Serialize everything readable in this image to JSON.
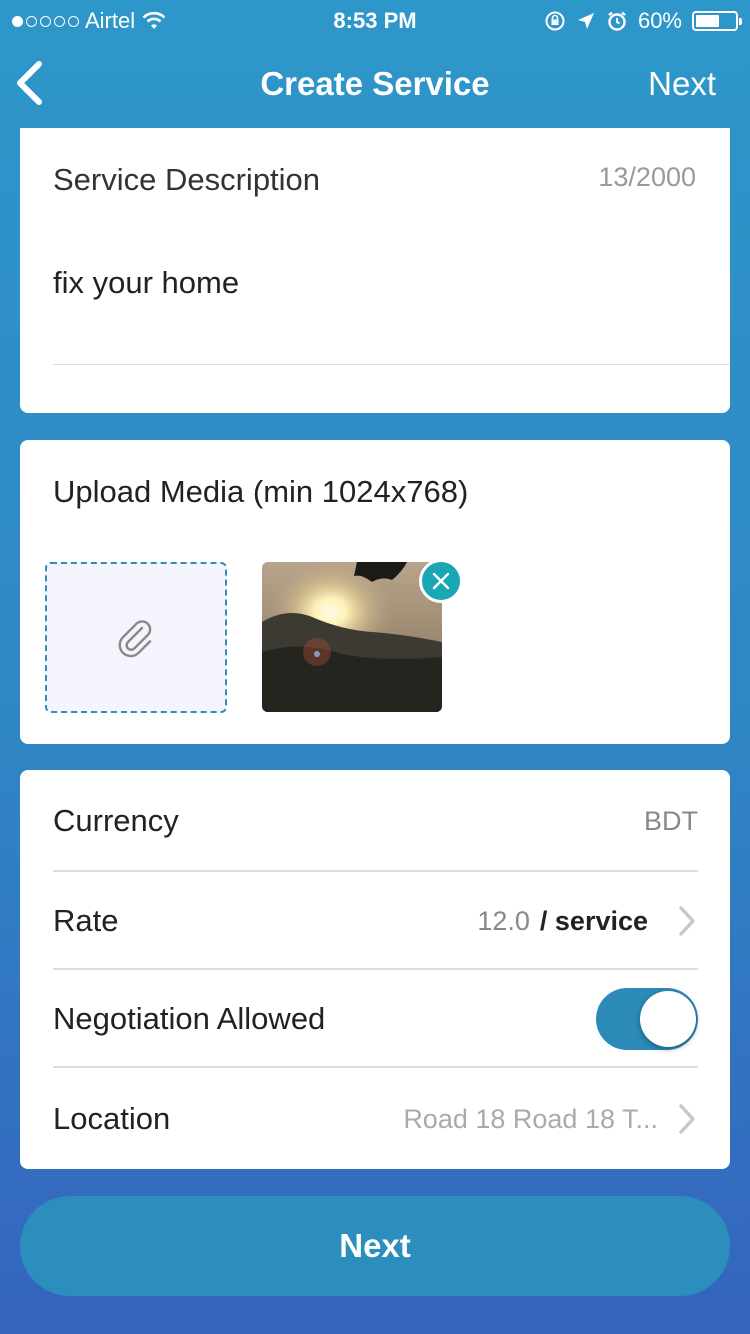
{
  "status_bar": {
    "carrier": "Airtel",
    "time": "8:53 PM",
    "battery": "60%",
    "battery_level": 0.6,
    "signal_bars_filled": 1,
    "signal_bars_total": 5
  },
  "nav": {
    "title": "Create Service",
    "next_label": "Next",
    "back_icon": "chevron-left-icon"
  },
  "description": {
    "label": "Service Description",
    "counter": "13/2000",
    "value": "fix your home"
  },
  "media": {
    "label": "Upload Media (min 1024x768)",
    "attach_icon": "paperclip-icon",
    "remove_icon": "close-icon"
  },
  "fields": {
    "currency": {
      "label": "Currency",
      "value": "BDT"
    },
    "rate": {
      "label": "Rate",
      "value": "12.0",
      "unit": "/ service"
    },
    "negotiation": {
      "label": "Negotiation Allowed",
      "enabled": true
    },
    "location": {
      "label": "Location",
      "value": "Road 18 Road 18 T..."
    }
  },
  "primary_button": {
    "label": "Next"
  },
  "colors": {
    "accent": "#2b8ebc",
    "remove_badge": "#1aa6b3"
  }
}
